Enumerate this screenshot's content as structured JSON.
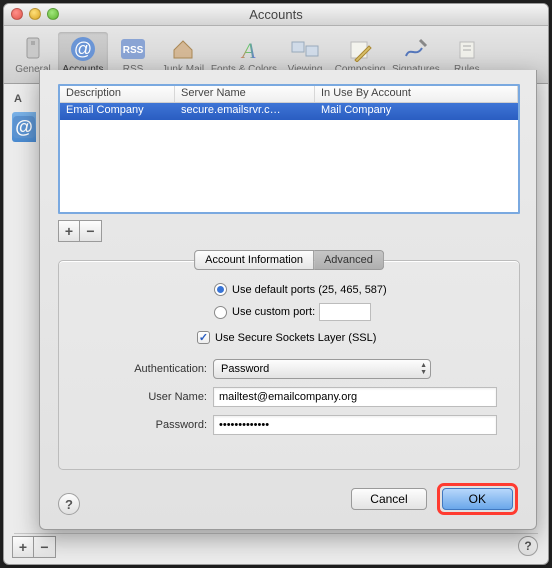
{
  "window": {
    "title": "Accounts"
  },
  "toolbar": {
    "items": [
      {
        "label": "General"
      },
      {
        "label": "Accounts"
      },
      {
        "label": "RSS"
      },
      {
        "label": "Junk Mail"
      },
      {
        "label": "Fonts & Colors"
      },
      {
        "label": "Viewing"
      },
      {
        "label": "Composing"
      },
      {
        "label": "Signatures"
      },
      {
        "label": "Rules"
      }
    ],
    "selected_index": 1
  },
  "sidebar": {
    "header_letter": "A",
    "at_symbol": "@"
  },
  "server_list": {
    "columns": [
      "Description",
      "Server Name",
      "In Use By Account"
    ],
    "rows": [
      {
        "description": "Email Company",
        "server": "secure.emailsrvr.c…",
        "in_use_by": "Mail Company"
      }
    ]
  },
  "addremove": {
    "plus": "+",
    "minus": "−"
  },
  "panel": {
    "tabs": {
      "info": "Account Information",
      "advanced": "Advanced",
      "selected": "advanced"
    },
    "ports": {
      "default_label": "Use default ports (25, 465, 587)",
      "custom_label": "Use custom port:",
      "selected": "default",
      "custom_value": ""
    },
    "ssl": {
      "label": "Use Secure Sockets Layer (SSL)",
      "checked": true,
      "checkmark": "✓"
    },
    "auth": {
      "label": "Authentication:",
      "value": "Password"
    },
    "username": {
      "label": "User Name:",
      "value": "mailtest@emailcompany.org"
    },
    "password": {
      "label": "Password:",
      "value": "•••••••••••••"
    }
  },
  "buttons": {
    "cancel": "Cancel",
    "ok": "OK",
    "help": "?"
  }
}
